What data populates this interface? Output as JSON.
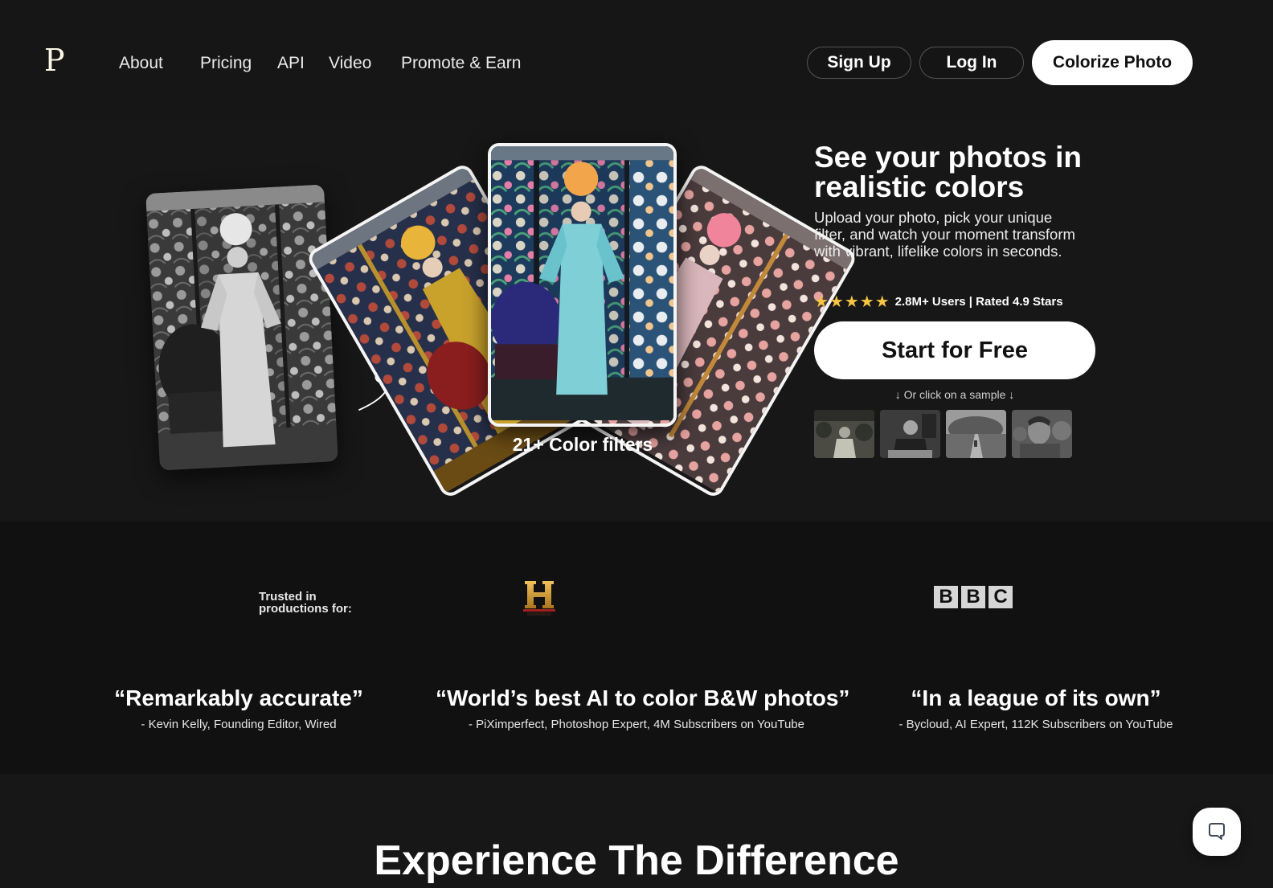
{
  "nav": {
    "logo": "P",
    "links": [
      {
        "label": "About"
      },
      {
        "label": "Pricing"
      },
      {
        "label": "API"
      },
      {
        "label": "Video"
      },
      {
        "label": "Promote & Earn"
      }
    ],
    "sign_up": "Sign Up",
    "log_in": "Log In",
    "colorize": "Colorize Photo"
  },
  "hero": {
    "title": "See your photos in realistic colors",
    "subtitle": "Upload your photo, pick your unique filter, and watch your moment transform with vibrant, lifelike colors in seconds.",
    "stars_icon": "★★★★★",
    "rating_text": "2.8M+ Users | Rated 4.9 Stars",
    "rating_value": 4.9,
    "cta": "Start for Free",
    "sample_hint": "↓ Or click on a sample ↓",
    "filters_caption": "21+ Color filters",
    "samples": [
      {
        "name": "sample-woman-garden"
      },
      {
        "name": "sample-man-desk"
      },
      {
        "name": "sample-garden-path"
      },
      {
        "name": "sample-migrant-mother"
      }
    ],
    "colors": {
      "star": "#f6c543"
    }
  },
  "trust": {
    "label_line1": "Trusted in",
    "label_line2": "productions for:",
    "logos": [
      "HISTORY",
      "BBC"
    ],
    "bbc_letters": [
      "B",
      "B",
      "C"
    ],
    "history_letter": "H"
  },
  "quotes": [
    {
      "text": "“Remarkably accurate”",
      "author": "- Kevin Kelly, Founding Editor, Wired"
    },
    {
      "text": "“World’s best AI to color B&W photos”",
      "author": "- PiXimperfect, Photoshop Expert, 4M Subscribers on YouTube"
    },
    {
      "text": "“In a league of its own”",
      "author": "- Bycloud, AI Expert, 112K Subscribers on YouTube"
    }
  ],
  "experience": {
    "title": "Experience The Difference"
  },
  "chat": {
    "icon": "chat-bubble-icon"
  }
}
